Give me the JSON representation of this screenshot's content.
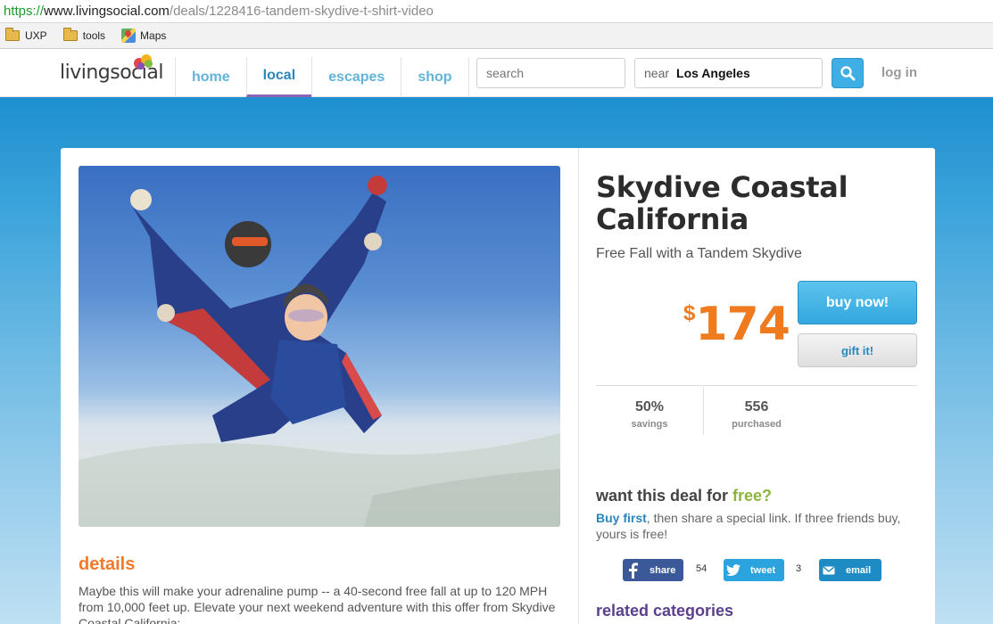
{
  "browser": {
    "url_scheme": "https://",
    "url_host": "www.livingsocial.com",
    "url_path": "/deals/1228416-tandem-skydive-t-shirt-video",
    "bookmarks": [
      {
        "label": "UXP",
        "icon": "folder-icon"
      },
      {
        "label": "tools",
        "icon": "folder-icon"
      },
      {
        "label": "Maps",
        "icon": "maps-icon"
      }
    ]
  },
  "header": {
    "logo_text": "livingsocial",
    "nav": [
      "home",
      "local",
      "escapes",
      "shop"
    ],
    "active_nav": "local",
    "search_placeholder": "search",
    "near_label": "near",
    "near_value": "Los Angeles",
    "login_label": "log in",
    "colors": {
      "accent": "#3eaee4",
      "active_underline": "#8c64b2"
    }
  },
  "deal": {
    "title": "Skydive Coastal California",
    "subtitle": "Free Fall with a Tandem Skydive",
    "price_currency": "$",
    "price_amount": "174",
    "buy_label": "buy now!",
    "gift_label": "gift it!",
    "stats": [
      {
        "value": "50%",
        "label": "savings"
      },
      {
        "value": "556",
        "label": "purchased"
      }
    ],
    "colors": {
      "price": "#f07a1e"
    }
  },
  "details": {
    "heading": "details",
    "text": "Maybe this will make your adrenaline pump -- a 40-second free fall at up to 120 MPH from 10,000 feet up. Elevate your next weekend adventure with this offer from Skydive Coastal California:"
  },
  "free_offer": {
    "heading_prefix": "want this deal for ",
    "heading_highlight": "free?",
    "buy_first": "Buy first",
    "text": ", then share a special link. If three friends buy, yours is free!"
  },
  "share": {
    "facebook": {
      "label": "share",
      "count": "54",
      "icon": "facebook-icon"
    },
    "twitter": {
      "label": "tweet",
      "count": "3",
      "icon": "twitter-icon"
    },
    "email": {
      "label": "email",
      "icon": "email-icon"
    }
  },
  "related": {
    "heading": "related categories"
  }
}
